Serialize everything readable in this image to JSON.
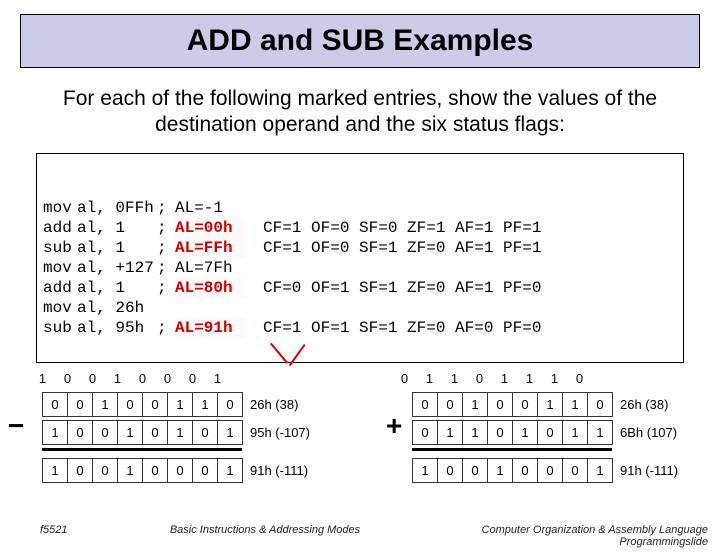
{
  "title": "ADD and SUB Examples",
  "intro": "For each of the following marked entries, show the values of the destination operand and the six status flags:",
  "code": {
    "rows": [
      {
        "instr": "mov",
        "args": "al, 0FFh",
        "al": "AL=-1",
        "al_bold": false,
        "flags": ""
      },
      {
        "instr": "add",
        "args": "al, 1",
        "al": "AL=00h",
        "al_bold": true,
        "flags": "CF=1 OF=0 SF=0 ZF=1 AF=1 PF=1"
      },
      {
        "instr": "sub",
        "args": "al, 1",
        "al": "AL=FFh",
        "al_bold": true,
        "flags": "CF=1 OF=0 SF=1 ZF=0 AF=1 PF=1"
      },
      {
        "instr": "mov",
        "args": "al, +127",
        "al": "AL=7Fh",
        "al_bold": false,
        "flags": ""
      },
      {
        "instr": "add",
        "args": "al, 1",
        "al": "AL=80h",
        "al_bold": true,
        "flags": "CF=0 OF=1 SF=1 ZF=0 AF=1 PF=0"
      },
      {
        "instr": "mov",
        "args": "al, 26h",
        "al": "",
        "al_bold": false,
        "flags": ""
      },
      {
        "instr": "sub",
        "args": "al, 95h",
        "al": "AL=91h",
        "al_bold": true,
        "flags": "CF=1 OF=1 SF=1 ZF=0 AF=0 PF=0"
      }
    ]
  },
  "bits": {
    "left": {
      "top": [
        "1",
        "0",
        "0",
        "1",
        "0",
        "0",
        "0",
        "1"
      ],
      "r1": [
        "0",
        "0",
        "1",
        "0",
        "0",
        "1",
        "1",
        "0"
      ],
      "r1_label": "26h (38)",
      "r2": [
        "1",
        "0",
        "0",
        "1",
        "0",
        "1",
        "0",
        "1"
      ],
      "r2_label": "95h (-107)",
      "r3": [
        "1",
        "0",
        "0",
        "1",
        "0",
        "0",
        "0",
        "1"
      ],
      "r3_label": "91h (-111)",
      "op": "−"
    },
    "right": {
      "top": [
        "0",
        "1",
        "1",
        "0",
        "1",
        "1",
        "1",
        "0"
      ],
      "r1": [
        "0",
        "0",
        "1",
        "0",
        "0",
        "1",
        "1",
        "0"
      ],
      "r1_label": "26h (38)",
      "r2": [
        "0",
        "1",
        "1",
        "0",
        "1",
        "0",
        "1",
        "1"
      ],
      "r2_label": "6Bh (107)",
      "r3": [
        "1",
        "0",
        "0",
        "1",
        "0",
        "0",
        "0",
        "1"
      ],
      "r3_label": "91h (-111)",
      "op": "+"
    }
  },
  "footer": {
    "left": "f5521",
    "center": "Basic Instructions & Addressing Modes",
    "right": "Computer Organization & Assembly Language Programmingslide"
  }
}
